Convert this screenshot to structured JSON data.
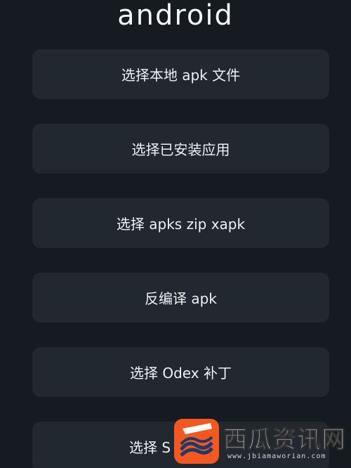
{
  "header": {
    "logo_text": "android"
  },
  "menu": {
    "select_local_apk": "选择本地 apk 文件",
    "select_installed_app": "选择已安装应用",
    "select_apks_zip_xapk": "选择 apks zip xapk",
    "decompile_apk": "反编译 apk",
    "select_odex_patch": "选择 Odex 补丁",
    "select_partial": "选择 S"
  },
  "watermark": {
    "text": "西瓜资讯网",
    "url": "www.jbiamaworian.com",
    "badge_color": "#f2581f"
  },
  "colors": {
    "background": "#161b22",
    "button": "#222830",
    "text": "#eef1f4"
  }
}
